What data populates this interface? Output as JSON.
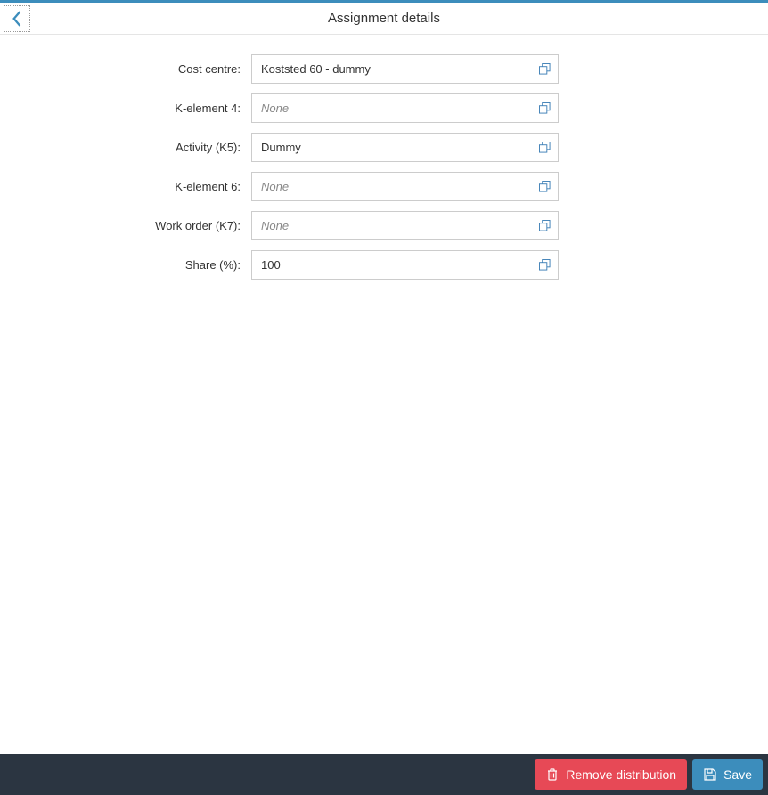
{
  "header": {
    "title": "Assignment details"
  },
  "form": {
    "cost_centre": {
      "label": "Cost centre:",
      "value": "Koststed 60 - dummy",
      "placeholder": "None"
    },
    "k_element_4": {
      "label": "K-element 4:",
      "value": "",
      "placeholder": "None"
    },
    "activity_k5": {
      "label": "Activity (K5):",
      "value": "Dummy",
      "placeholder": "None"
    },
    "k_element_6": {
      "label": "K-element 6:",
      "value": "",
      "placeholder": "None"
    },
    "work_order_k7": {
      "label": "Work order (K7):",
      "value": "",
      "placeholder": "None"
    },
    "share": {
      "label": "Share (%):",
      "value": "100",
      "placeholder": ""
    }
  },
  "footer": {
    "remove_label": "Remove distribution",
    "save_label": "Save"
  }
}
